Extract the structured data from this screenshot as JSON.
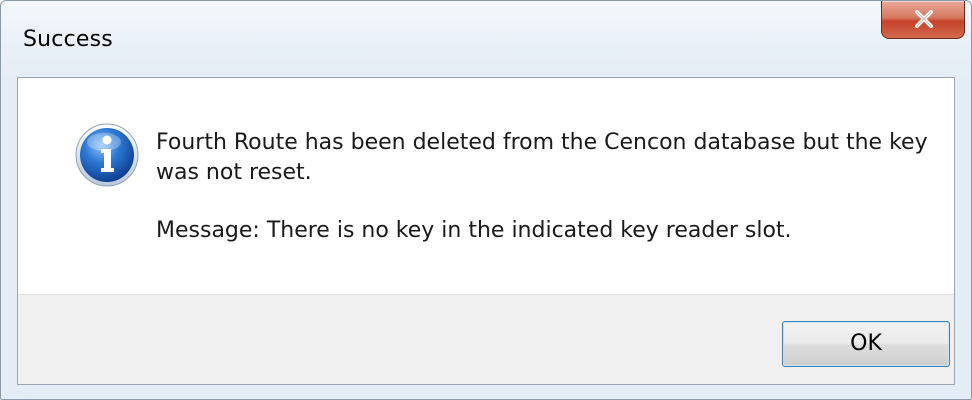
{
  "window": {
    "title": "Success"
  },
  "title_bar": {
    "close_icon": "close-icon"
  },
  "message": {
    "icon": "info-icon",
    "line1": "Fourth Route has been deleted from the Cencon database but the key",
    "line2": "was not reset.",
    "line3": "Message: There is no key in the indicated key reader slot."
  },
  "buttons": {
    "ok_label": "OK"
  },
  "colors": {
    "close_button": "#c4422a",
    "info_icon_blue": "#1d5fb8",
    "button_area": "#f0f0f0"
  }
}
